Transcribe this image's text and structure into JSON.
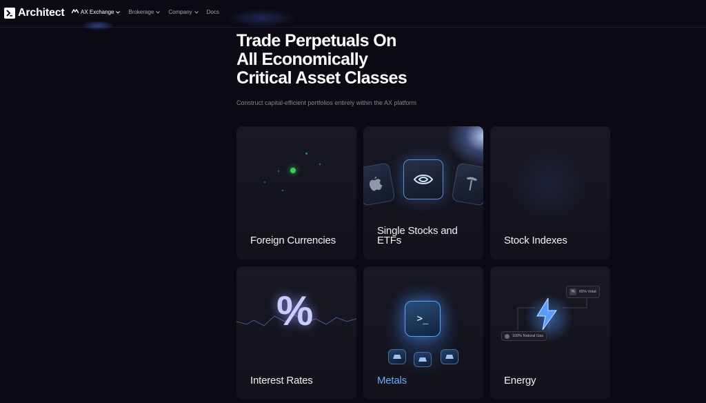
{
  "nav": {
    "brand": "Architect",
    "items": [
      {
        "label": "AX Exchange",
        "active": true
      },
      {
        "label": "Brokerage",
        "active": false
      },
      {
        "label": "Company",
        "active": false
      },
      {
        "label": "Docs",
        "active": false
      }
    ]
  },
  "hero": {
    "title_lines": [
      "Trade Perpetuals On",
      "All Economically",
      "Critical Asset Classes"
    ],
    "subtitle": "Construct capital-efficient portfolios entirely within the AX platform"
  },
  "cards": [
    {
      "label": "Foreign Currencies",
      "icon": "fx-dots-icon"
    },
    {
      "label": "Single Stocks and ETFs",
      "icon": "stock-logos-icon"
    },
    {
      "label": "Stock Indexes",
      "icon": "index-icon"
    },
    {
      "label": "Interest Rates",
      "icon": "percent-icon"
    },
    {
      "label": "Metals",
      "icon": "terminal-icon",
      "highlighted": true
    },
    {
      "label": "Energy",
      "icon": "bolt-icon",
      "tags": [
        "65% Volat",
        "100% Natural Gas"
      ]
    }
  ],
  "colors": {
    "background": "#0b0a14",
    "card": "#161620",
    "accent_blue": "#6aa8ff",
    "fx_green": "#39d353"
  }
}
